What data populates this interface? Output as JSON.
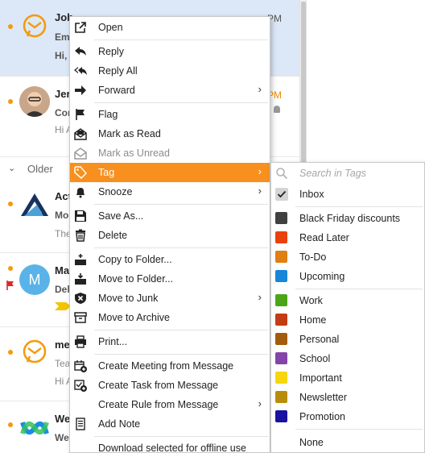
{
  "mail_list": {
    "rows": [
      {
        "name": "Joh",
        "line1": "Ema",
        "line2": "Hi,",
        "time": "PM",
        "time_orange": false,
        "avatar": "emclient-logo"
      },
      {
        "name": "Jer",
        "line1": "Cor",
        "line2": "Hi A",
        "time": "PM",
        "time_orange": true,
        "avatar": "person-photo"
      },
      {
        "name": "Act",
        "line1": "Mo",
        "line2": "The",
        "time": "",
        "avatar": "mountain-logo"
      },
      {
        "name": "Ma",
        "line1": "Del",
        "line2": "",
        "time": "",
        "avatar_letter": "M"
      },
      {
        "name": "me",
        "line1": "Tea",
        "line2": "Hi A",
        "time": "",
        "avatar": "emclient-logo"
      },
      {
        "name": "We",
        "line1": "We",
        "line2": "",
        "time": "",
        "avatar": "webex-logo"
      }
    ],
    "group_older": "Older"
  },
  "context_menu": {
    "items": [
      {
        "label": "Open",
        "icon": "open-external-icon"
      },
      {
        "label": "Reply",
        "icon": "reply-icon"
      },
      {
        "label": "Reply All",
        "icon": "reply-all-icon"
      },
      {
        "label": "Forward",
        "icon": "forward-icon",
        "submenu": true
      },
      {
        "label": "Flag",
        "icon": "flag-icon"
      },
      {
        "label": "Mark as Read",
        "icon": "mark-read-icon"
      },
      {
        "label": "Mark as Unread",
        "icon": "mark-unread-icon",
        "disabled": true
      },
      {
        "label": "Tag",
        "icon": "tag-icon",
        "submenu": true,
        "highlighted": true
      },
      {
        "label": "Snooze",
        "icon": "bell-icon",
        "submenu": true
      },
      {
        "label": "Save As...",
        "icon": "save-icon"
      },
      {
        "label": "Delete",
        "icon": "trash-icon"
      },
      {
        "label": "Copy to Folder...",
        "icon": "copy-folder-icon"
      },
      {
        "label": "Move to Folder...",
        "icon": "move-folder-icon"
      },
      {
        "label": "Move to Junk",
        "icon": "junk-icon",
        "submenu": true
      },
      {
        "label": "Move to Archive",
        "icon": "archive-icon"
      },
      {
        "label": "Print...",
        "icon": "printer-icon"
      },
      {
        "label": "Create Meeting from Message",
        "icon": "calendar-add-icon"
      },
      {
        "label": "Create Task from Message",
        "icon": "task-add-icon"
      },
      {
        "label": "Create Rule from Message",
        "icon": "rule-icon",
        "submenu": true
      },
      {
        "label": "Add Note",
        "icon": "note-icon"
      },
      {
        "label": "Download selected for offline use",
        "icon": ""
      }
    ]
  },
  "tag_submenu": {
    "search_placeholder": "Search in Tags",
    "inbox_label": "Inbox",
    "tags": [
      {
        "label": "Black Friday discounts",
        "color": "#404040"
      },
      {
        "label": "Read Later",
        "color": "#e8410c"
      },
      {
        "label": "To-Do",
        "color": "#e07f12"
      },
      {
        "label": "Upcoming",
        "color": "#1786d9"
      },
      {
        "label": "Work",
        "color": "#4ca518"
      },
      {
        "label": "Home",
        "color": "#c23c14"
      },
      {
        "label": "Personal",
        "color": "#a25c0b"
      },
      {
        "label": "School",
        "color": "#8444a8"
      },
      {
        "label": "Important",
        "color": "#f7d60d"
      },
      {
        "label": "Newsletter",
        "color": "#b88d0c"
      },
      {
        "label": "Promotion",
        "color": "#1c12a0"
      }
    ],
    "none_label": "None"
  },
  "colors": {
    "accent": "#f7901e",
    "selected_row": "#dce8f7",
    "unread_dot": "#f39b0f"
  }
}
